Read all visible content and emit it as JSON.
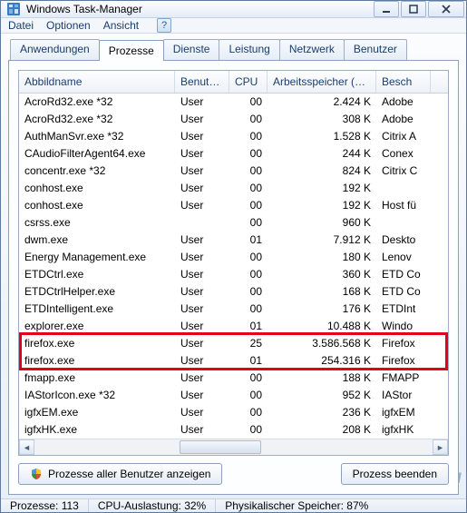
{
  "window": {
    "title": "Windows Task-Manager"
  },
  "menu": {
    "file": "Datei",
    "options": "Optionen",
    "view": "Ansicht"
  },
  "tabs": {
    "apps": "Anwendungen",
    "processes": "Prozesse",
    "services": "Dienste",
    "performance": "Leistung",
    "network": "Netzwerk",
    "users": "Benutzer"
  },
  "columns": {
    "image": "Abbildname",
    "user": "Benutze...",
    "cpu": "CPU",
    "mem": "Arbeitsspeicher (pri...",
    "desc": "Besch"
  },
  "rows": [
    {
      "name": "AcroRd32.exe *32",
      "user": "User",
      "cpu": "00",
      "mem": "2.424 K",
      "desc": "Adobe"
    },
    {
      "name": "AcroRd32.exe *32",
      "user": "User",
      "cpu": "00",
      "mem": "308 K",
      "desc": "Adobe"
    },
    {
      "name": "AuthManSvr.exe *32",
      "user": "User",
      "cpu": "00",
      "mem": "1.528 K",
      "desc": "Citrix A"
    },
    {
      "name": "CAudioFilterAgent64.exe",
      "user": "User",
      "cpu": "00",
      "mem": "244 K",
      "desc": "Conex"
    },
    {
      "name": "concentr.exe *32",
      "user": "User",
      "cpu": "00",
      "mem": "824 K",
      "desc": "Citrix C"
    },
    {
      "name": "conhost.exe",
      "user": "User",
      "cpu": "00",
      "mem": "192 K",
      "desc": ""
    },
    {
      "name": "conhost.exe",
      "user": "User",
      "cpu": "00",
      "mem": "192 K",
      "desc": "Host fü"
    },
    {
      "name": "csrss.exe",
      "user": "",
      "cpu": "00",
      "mem": "960 K",
      "desc": ""
    },
    {
      "name": "dwm.exe",
      "user": "User",
      "cpu": "01",
      "mem": "7.912 K",
      "desc": "Deskto"
    },
    {
      "name": "Energy Management.exe",
      "user": "User",
      "cpu": "00",
      "mem": "180 K",
      "desc": "Lenov"
    },
    {
      "name": "ETDCtrl.exe",
      "user": "User",
      "cpu": "00",
      "mem": "360 K",
      "desc": "ETD Co"
    },
    {
      "name": "ETDCtrlHelper.exe",
      "user": "User",
      "cpu": "00",
      "mem": "168 K",
      "desc": "ETD Co"
    },
    {
      "name": "ETDIntelligent.exe",
      "user": "User",
      "cpu": "00",
      "mem": "176 K",
      "desc": "ETDInt"
    },
    {
      "name": "explorer.exe",
      "user": "User",
      "cpu": "01",
      "mem": "10.488 K",
      "desc": "Windo"
    },
    {
      "name": "firefox.exe",
      "user": "User",
      "cpu": "25",
      "mem": "3.586.568 K",
      "desc": "Firefox"
    },
    {
      "name": "firefox.exe",
      "user": "User",
      "cpu": "01",
      "mem": "254.316 K",
      "desc": "Firefox"
    },
    {
      "name": "fmapp.exe",
      "user": "User",
      "cpu": "00",
      "mem": "188 K",
      "desc": "FMAPP"
    },
    {
      "name": "IAStorIcon.exe *32",
      "user": "User",
      "cpu": "00",
      "mem": "952 K",
      "desc": "IAStor"
    },
    {
      "name": "igfxEM.exe",
      "user": "User",
      "cpu": "00",
      "mem": "236 K",
      "desc": "igfxEM"
    },
    {
      "name": "igfxHK.exe",
      "user": "User",
      "cpu": "00",
      "mem": "208 K",
      "desc": "igfxHK"
    }
  ],
  "highlight": {
    "from": 14,
    "to": 15
  },
  "buttons": {
    "showAll": "Prozesse aller Benutzer anzeigen",
    "end": "Prozess beenden"
  },
  "status": {
    "processes": "Prozesse: 113",
    "cpu": "CPU-Auslastung: 32%",
    "mem": "Physikalischer Speicher: 87%"
  },
  "watermark": "YAPLAKAL.COM"
}
